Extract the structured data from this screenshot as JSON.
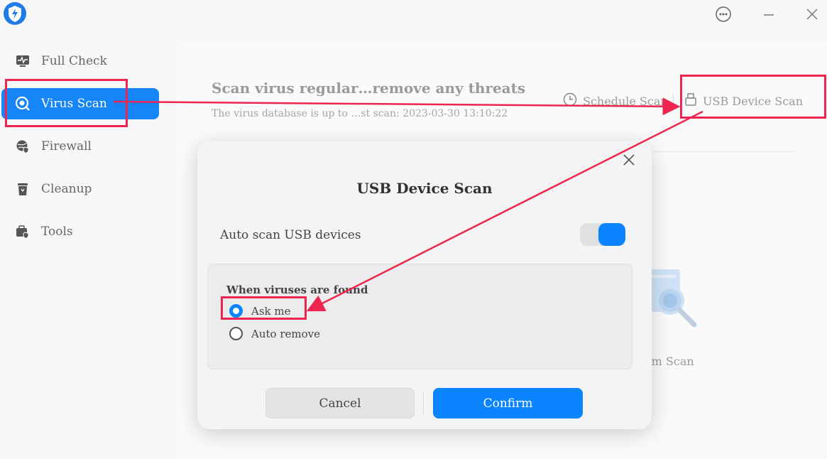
{
  "window": {
    "more_icon": "more-horizontal-icon",
    "minimize_icon": "minimize-icon",
    "close_icon": "close-icon"
  },
  "sidebar": {
    "items": [
      {
        "label": "Full Check",
        "icon": "pulse-monitor-icon",
        "active": false
      },
      {
        "label": "Virus Scan",
        "icon": "virus-scan-icon",
        "active": true
      },
      {
        "label": "Firewall",
        "icon": "firewall-globe-icon",
        "active": false
      },
      {
        "label": "Cleanup",
        "icon": "trash-icon",
        "active": false
      },
      {
        "label": "Tools",
        "icon": "toolbox-icon",
        "active": false
      }
    ]
  },
  "main": {
    "title": "Scan virus regular…remove any threats",
    "subtitle": "The virus database is up to …st scan: 2023-03-30 13:10:22",
    "schedule_scan": "Schedule Scan",
    "usb_device_scan": "USB Device Scan",
    "custom_scan_partial": "om Scan"
  },
  "dialog": {
    "title": "USB Device Scan",
    "auto_scan_label": "Auto scan USB devices",
    "auto_scan_enabled": true,
    "options_title": "When viruses are found",
    "options": [
      {
        "label": "Ask me",
        "checked": true
      },
      {
        "label": "Auto remove",
        "checked": false
      }
    ],
    "cancel": "Cancel",
    "confirm": "Confirm"
  },
  "colors": {
    "accent": "#0a84ff",
    "sidebar_active": "#1685f7",
    "annotation": "#ee2550"
  }
}
